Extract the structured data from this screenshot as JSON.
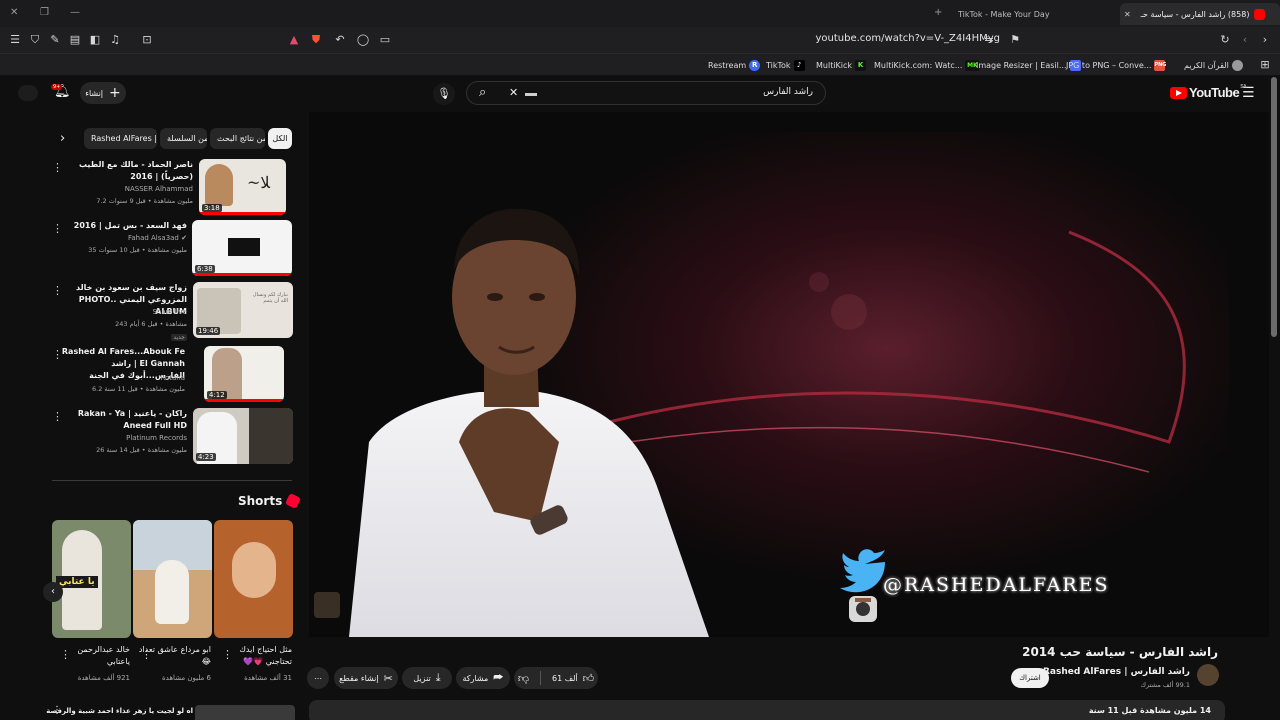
{
  "browser": {
    "tabs": [
      {
        "title": "TikTok - Make Your Day",
        "active": false
      },
      {
        "title": "(858) راشد الفارس - سياسة حـ",
        "active": true
      }
    ],
    "url": "youtube.com/watch?v=V-_Z4I4HMyg",
    "bookmarks": [
      {
        "label": "Restream",
        "icon": "R",
        "color": "#3e6bf6"
      },
      {
        "label": "TikTok",
        "icon": "♪",
        "color": "#000000"
      },
      {
        "label": "MultiKick",
        "icon": "K",
        "color": "#53fc18"
      },
      {
        "label": "MultiKick.com: Watc...",
        "icon": "MK",
        "color": "#53fc18"
      },
      {
        "label": "Image Resizer | Easil...",
        "icon": "",
        "color": "#4a6cf7"
      },
      {
        "label": "JPG to PNG – Conve...",
        "icon": "PNG",
        "color": "#e94f3d"
      },
      {
        "label": "القرآن الكريم",
        "icon": "",
        "color": "#9a9a9a"
      }
    ]
  },
  "youtube": {
    "logo_text": "YouTube",
    "country_code": "SA",
    "search_query": "راشد الفارس",
    "create_label": "إنشاء",
    "notif_count": "9+"
  },
  "chips": [
    {
      "label": "الكل",
      "selected": true
    },
    {
      "label": "من نتائج البحث",
      "selected": false
    },
    {
      "label": "من السلسلة",
      "selected": false
    },
    {
      "label": "من راشد الفارس | Rashed AlFares",
      "selected": false
    }
  ],
  "recommended": [
    {
      "title": "ناصر الحماد - مالك مع الطيب (حصرياً) | 2016",
      "channel": "NASSER Alhammad",
      "meta": "7.2 مليون مشاهدة • قبل 9 سنوات",
      "duration": "3:18",
      "new_badge": "",
      "thumb_bg": "#e9e6df",
      "watched": true
    },
    {
      "title": "فهد السعد - بس تمل | 2016",
      "channel": "Fahad Alsa3ad",
      "meta": "35 مليون مشاهدة • قبل 10 سنوات",
      "duration": "6:38",
      "new_badge": "",
      "thumb_bg": "#f4f4f4",
      "watched": true
    },
    {
      "title": "زواج سيف بن سعود بن خالد المزروعي اليمني ..PHOTO ALBUM",
      "channel": "Sham live",
      "meta": "243 مشاهدة • قبل 6 أيام",
      "duration": "19:46",
      "new_badge": "جديد",
      "thumb_bg": "#e8e4dd",
      "watched": false
    },
    {
      "title": "Rashed Al Fares...Abouk Fe El Gannah | راشد الفارس...أبوك في الجنة",
      "channel": "Rotana",
      "meta": "6.2 مليون مشاهدة • قبل 11 سنة",
      "duration": "4:12",
      "new_badge": "",
      "thumb_bg": "#f0efe9",
      "watched": true
    },
    {
      "title": "راكان - ياعنيد | Rakan - Ya Aneed Full HD",
      "channel": "Platinum Records",
      "meta": "26 مليون مشاهدة • قبل 14 سنة",
      "duration": "4:23",
      "new_badge": "",
      "thumb_bg": "#cfcac2",
      "watched": false
    }
  ],
  "shorts": {
    "heading": "Shorts",
    "items": [
      {
        "caption": "خالد عبدالرحمن ياعتابي",
        "views": "921 ألف مشاهدة",
        "bg": "#7a8a6a",
        "overlay": "يا عتابي"
      },
      {
        "caption": "ابو مرداع عاشق تعداد 😂",
        "views": "6 مليون مشاهدة",
        "bg": "#cfa57a",
        "overlay": ""
      },
      {
        "caption": "مثل احتياج ايدك تحتاجني 💗💜",
        "views": "31 ألف مشاهدة",
        "bg": "#b5622c",
        "overlay": ""
      }
    ]
  },
  "bottom_item_title": "اه لو لجيت يا زهر عذاء احمد شبية والرفصة",
  "player": {
    "twitter_handle": "@RASHEDALFARES"
  },
  "video": {
    "title": "راشد الفارس - سياسة حب 2014",
    "channel": "راشد الفارس | Rashed AlFares",
    "subscribers": "99.1 ألف مشترك",
    "subscribe_label": "اشتراك",
    "likes": "61 ألف",
    "share_label": "مشاركة",
    "download_label": "تنزيل",
    "clip_label": "إنشاء مقطع",
    "views_date": "14 مليون مشاهدة قبل 11 سنة"
  },
  "colors": {
    "accent": "#ff0000",
    "bg": "#0f0f0f",
    "chip": "#272727"
  }
}
